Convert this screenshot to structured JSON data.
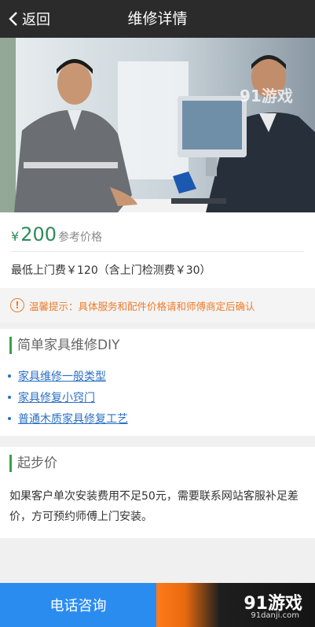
{
  "header": {
    "back_label": "返回",
    "title": "维修详情"
  },
  "hero": {
    "watermark": "91游戏"
  },
  "price": {
    "currency": "¥",
    "amount": "200",
    "reference_label": "参考价格",
    "fee_text": "最低上门费￥120（含上门检测费￥30）"
  },
  "tip": {
    "icon": "!",
    "text": "温馨提示：具体服务和配件价格请和师傅商定后确认"
  },
  "diy": {
    "title": "简单家具维修DIY",
    "links": [
      "家具维修一般类型",
      "家具修复小窍门",
      "普通木质家具修复工艺"
    ]
  },
  "starting_price": {
    "title": "起步价",
    "description": "如果客户单次安装费用不足50元，需要联系网站客服补足差价，方可预约师傅上门安装。"
  },
  "footer": {
    "call_label": "电话咨询",
    "brand_logo": "91游戏",
    "brand_url": "91danji.com"
  },
  "colors": {
    "header_bg": "#2b2b2b",
    "price_green": "#2e8b57",
    "tip_orange": "#ee7b2b",
    "link_blue": "#2a6fc4",
    "call_blue": "#2b8cf0",
    "section_accent": "#3aa14a"
  }
}
